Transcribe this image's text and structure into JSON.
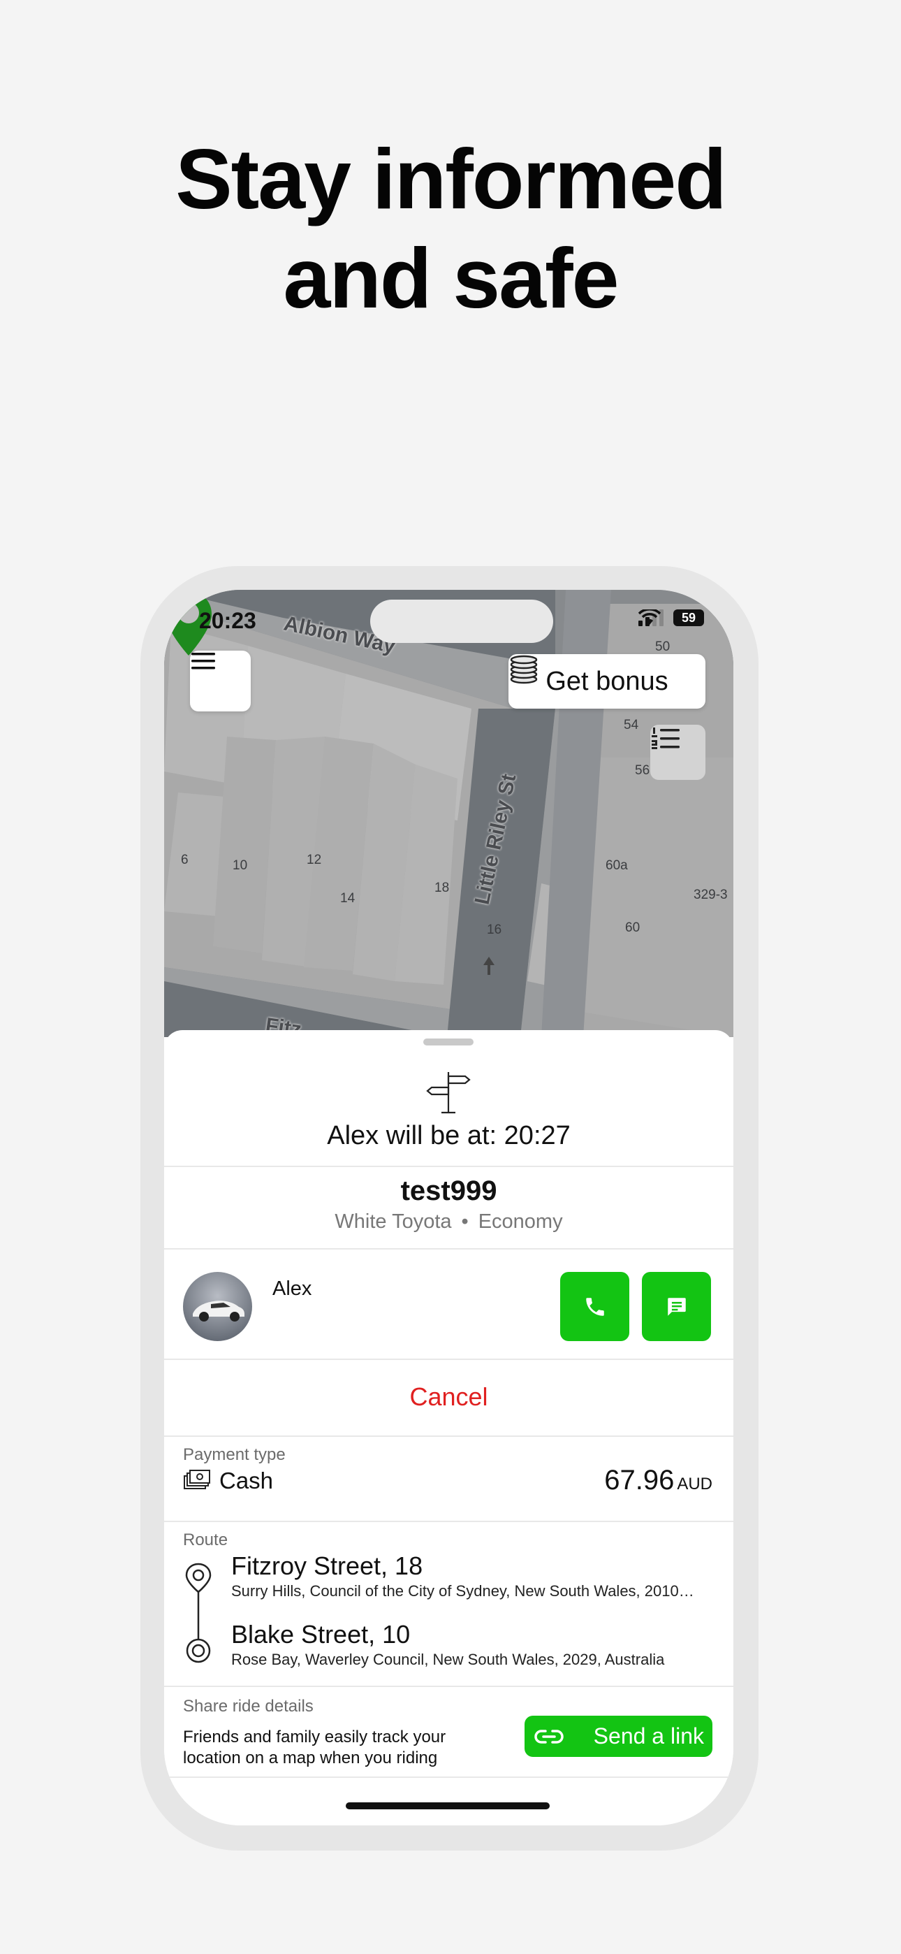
{
  "headline": {
    "line1": "Stay informed",
    "line2": "and safe"
  },
  "status_bar": {
    "time": "20:23",
    "battery": "59"
  },
  "map": {
    "streets": {
      "albion": "Albion Way",
      "little_riley": "Little Riley St",
      "bottom": "Fitz"
    },
    "house_numbers": [
      "50",
      "54",
      "56",
      "6",
      "10",
      "12",
      "14",
      "18",
      "16",
      "60a",
      "60",
      "329-3"
    ]
  },
  "map_buttons": {
    "bonus_label": "Get bonus"
  },
  "trip": {
    "eta_text": "Alex will be at: 20:27",
    "plate": "test999",
    "car_model": "White Toyota",
    "separator": "•",
    "car_class": "Economy",
    "driver_name": "Alex",
    "cancel_label": "Cancel"
  },
  "payment": {
    "label": "Payment type",
    "method": "Cash",
    "amount": "67.96",
    "currency": "AUD"
  },
  "route": {
    "label": "Route",
    "from_title": "Fitzroy Street, 18",
    "from_sub": "Surry Hills, Council of the City of Sydney, New South Wales, 2010…",
    "to_title": "Blake Street, 10",
    "to_sub": "Rose Bay, Waverley Council, New South Wales, 2029, Australia"
  },
  "share": {
    "label": "Share ride details",
    "description": "Friends and family easily track your location on a map when you riding",
    "button_label": "Send a link"
  },
  "colors": {
    "accent_green": "#13c413",
    "danger_red": "#e02020",
    "pin_green": "#1e8a1e"
  }
}
